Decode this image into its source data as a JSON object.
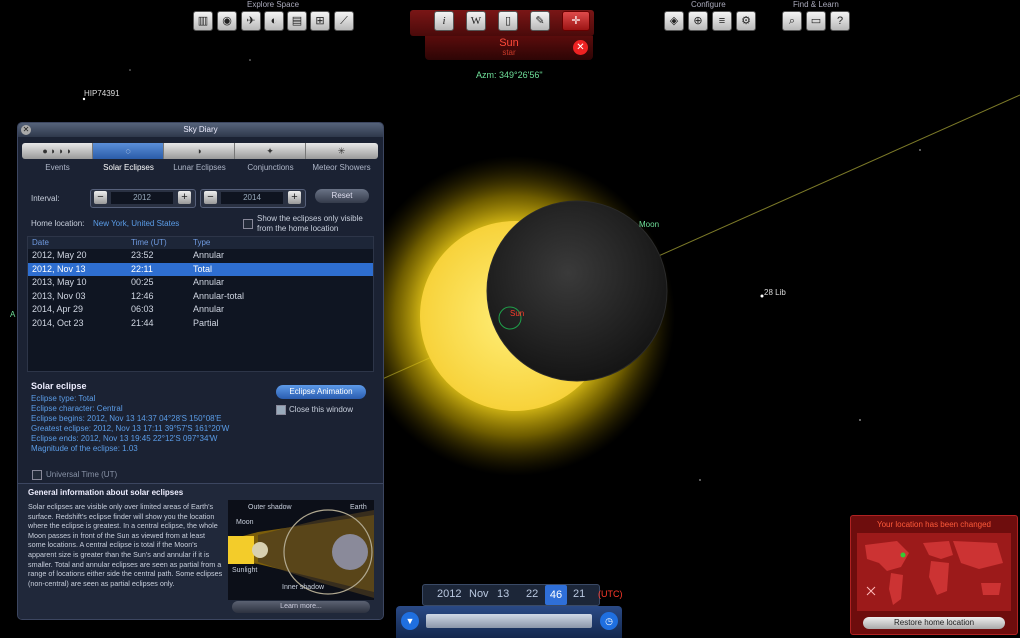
{
  "toolbar": {
    "explore_title": "Explore Space",
    "configure_title": "Configure",
    "find_title": "Find & Learn",
    "info_label": "i",
    "wiki_label": "W",
    "help_label": "?"
  },
  "object": {
    "name": "Sun",
    "type": "star",
    "azimuth": "Azm: 349°26'56\""
  },
  "sky_labels": {
    "hip": "HIP74391",
    "moon": "Moon",
    "lib": "28 Lib",
    "sun": "Sun",
    "edge": "A"
  },
  "diary": {
    "title": "Sky Diary",
    "tabs": [
      {
        "label": "Events"
      },
      {
        "label": "Solar Eclipses"
      },
      {
        "label": "Lunar Eclipses"
      },
      {
        "label": "Conjunctions"
      },
      {
        "label": "Meteor Showers"
      }
    ],
    "interval_label": "Interval:",
    "from_year": "2012",
    "to_year": "2014",
    "reset_label": "Reset",
    "home_label": "Home location:",
    "home_value": "New York, United States",
    "only_home_label_1": "Show the eclipses only visible",
    "only_home_label_2": "from the home location",
    "columns": {
      "date": "Date",
      "time": "Time (UT)",
      "type": "Type"
    },
    "rows": [
      {
        "date": "2012, May 20",
        "time": "23:52",
        "type": "Annular"
      },
      {
        "date": "2012, Nov 13",
        "time": "22:11",
        "type": "Total"
      },
      {
        "date": "2013, May 10",
        "time": "00:25",
        "type": "Annular"
      },
      {
        "date": "2013, Nov 03",
        "time": "12:46",
        "type": "Annular-total"
      },
      {
        "date": "2014, Apr 29",
        "time": "06:03",
        "type": "Annular"
      },
      {
        "date": "2014, Oct 23",
        "time": "21:44",
        "type": "Partial"
      }
    ],
    "detail": {
      "title": "Solar eclipse",
      "lines": [
        "Eclipse type: Total",
        "Eclipse character: Central",
        "Eclipse begins: 2012, Nov 13 14:37  04°28'S 150°08'E",
        "Greatest eclipse: 2012, Nov 13 17:11  39°57'S 161°20'W",
        "Eclipse ends: 2012, Nov 13 19:45  22°12'S 097°34'W",
        "Magnitude of the eclipse:   1.03"
      ],
      "animation_button": "Eclipse Animation",
      "close_window_label": "Close this window",
      "universal_time_label": "Universal Time (UT)"
    },
    "general": {
      "title": "General information about solar eclipses",
      "text": "Solar eclipses are visible only over limited areas of Earth's surface. Redshift's eclipse finder will show you the location where the eclipse is greatest. In a central eclipse, the whole Moon passes in front of the Sun as viewed from at least some locations. A central eclipse is total if the Moon's apparent size is greater than the Sun's and annular if it is smaller. Total and annular eclipses are seen as partial from a range of locations either side the central path. Some eclipses (non-central) are seen as partial eclipses only.",
      "diagram_labels": {
        "outer_shadow": "Outer shadow",
        "earth": "Earth",
        "moon": "Moon",
        "sunlight": "Sunlight",
        "inner_shadow": "Inner shadow"
      },
      "learn_more": "Learn more..."
    }
  },
  "time": {
    "year": "2012",
    "month": "Nov",
    "day": "13",
    "hour": "22",
    "minute": "46",
    "second": "21",
    "zone": "(UTC)"
  },
  "location": {
    "title": "Your location has been changed",
    "restore_button": "Restore home location"
  },
  "colors": {
    "accent_blue": "#2f6fd8",
    "alert_red": "#ff3a2a",
    "sun_yellow": "#f5d83a",
    "label_green": "#6fe09a"
  }
}
